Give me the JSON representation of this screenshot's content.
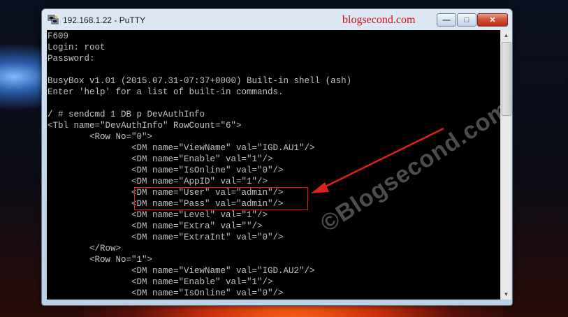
{
  "window": {
    "title": "192.168.1.22 - PuTTY",
    "watermark_top": "blogsecond.com",
    "min_glyph": "—",
    "max_glyph": "□",
    "close_glyph": "✕"
  },
  "terminal": {
    "lines": [
      "F609",
      "Login: root",
      "Password:",
      "",
      "BusyBox v1.01 (2015.07.31-07:37+0000) Built-in shell (ash)",
      "Enter 'help' for a list of built-in commands.",
      "",
      "/ # sendcmd 1 DB p DevAuthInfo",
      "<Tbl name=\"DevAuthInfo\" RowCount=\"6\">",
      "        <Row No=\"0\">",
      "                <DM name=\"ViewName\" val=\"IGD.AU1\"/>",
      "                <DM name=\"Enable\" val=\"1\"/>",
      "                <DM name=\"IsOnline\" val=\"0\"/>",
      "                <DM name=\"AppID\" val=\"1\"/>",
      "                <DM name=\"User\" val=\"admin\"/>",
      "                <DM name=\"Pass\" val=\"admin\"/>",
      "                <DM name=\"Level\" val=\"1\"/>",
      "                <DM name=\"Extra\" val=\"\"/>",
      "                <DM name=\"ExtraInt\" val=\"0\"/>",
      "        </Row>",
      "        <Row No=\"1\">",
      "                <DM name=\"ViewName\" val=\"IGD.AU2\"/>",
      "                <DM name=\"Enable\" val=\"1\"/>",
      "                <DM name=\"IsOnline\" val=\"0\"/>"
    ],
    "watermark_diagonal": "©Blogsecond.com",
    "annotation_color": "#e02020"
  },
  "scrollbar": {
    "up_glyph": "▲",
    "down_glyph": "▼"
  }
}
